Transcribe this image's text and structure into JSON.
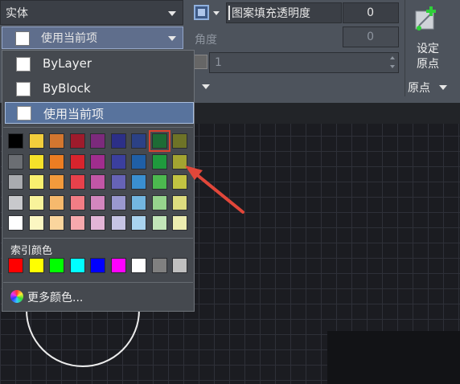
{
  "ribbon": {
    "fill_type": "实体",
    "color_select": "使用当前项",
    "transparency_label": "图案填充透明度",
    "transparency_value": "0",
    "angle_label": "角度",
    "angle_value": "0",
    "scale_value": "1",
    "origin_button": "设定\n原点",
    "origin_panel": "原点"
  },
  "dropdown": {
    "options": [
      {
        "label": "ByLayer"
      },
      {
        "label": "ByBlock"
      },
      {
        "label": "使用当前项"
      }
    ],
    "selected_index": 2,
    "standard_colors": [
      [
        "#000000",
        "#f2cd3c",
        "#d2762f",
        "#9e1b2c",
        "#7c2a7c",
        "#2c2f87",
        "#2b4185",
        "#1d6b35",
        "#6e7327"
      ],
      [
        "#6b6e73",
        "#f5e12a",
        "#ec7d22",
        "#d8242d",
        "#a02d8e",
        "#3b3f9e",
        "#1f5fa6",
        "#1f9a3d",
        "#a3a431"
      ],
      [
        "#a9abaf",
        "#f8ef6f",
        "#f29a3c",
        "#e8414b",
        "#c256a6",
        "#6663b6",
        "#3a8fd0",
        "#4cb94f",
        "#c2c342"
      ],
      [
        "#c8c9cc",
        "#f8f39b",
        "#f6b96d",
        "#f27d85",
        "#d386be",
        "#9a98cf",
        "#73b6e1",
        "#96d38d",
        "#dddc7f"
      ],
      [
        "#ffffff",
        "#fbf7c2",
        "#fad59d",
        "#f7a9ad",
        "#e3b5d7",
        "#c6c4e4",
        "#a9d3ef",
        "#c2e5b9",
        "#ececb0"
      ]
    ],
    "highlighted_cell": {
      "row": 0,
      "col": 7
    },
    "index_label": "索引颜色",
    "index_colors": [
      "#ff0000",
      "#ffff00",
      "#00ff00",
      "#00ffff",
      "#0000ff",
      "#ff00ff",
      "#ffffff",
      "#808080",
      "#c0c0c0"
    ],
    "more_colors": "更多颜色..."
  }
}
